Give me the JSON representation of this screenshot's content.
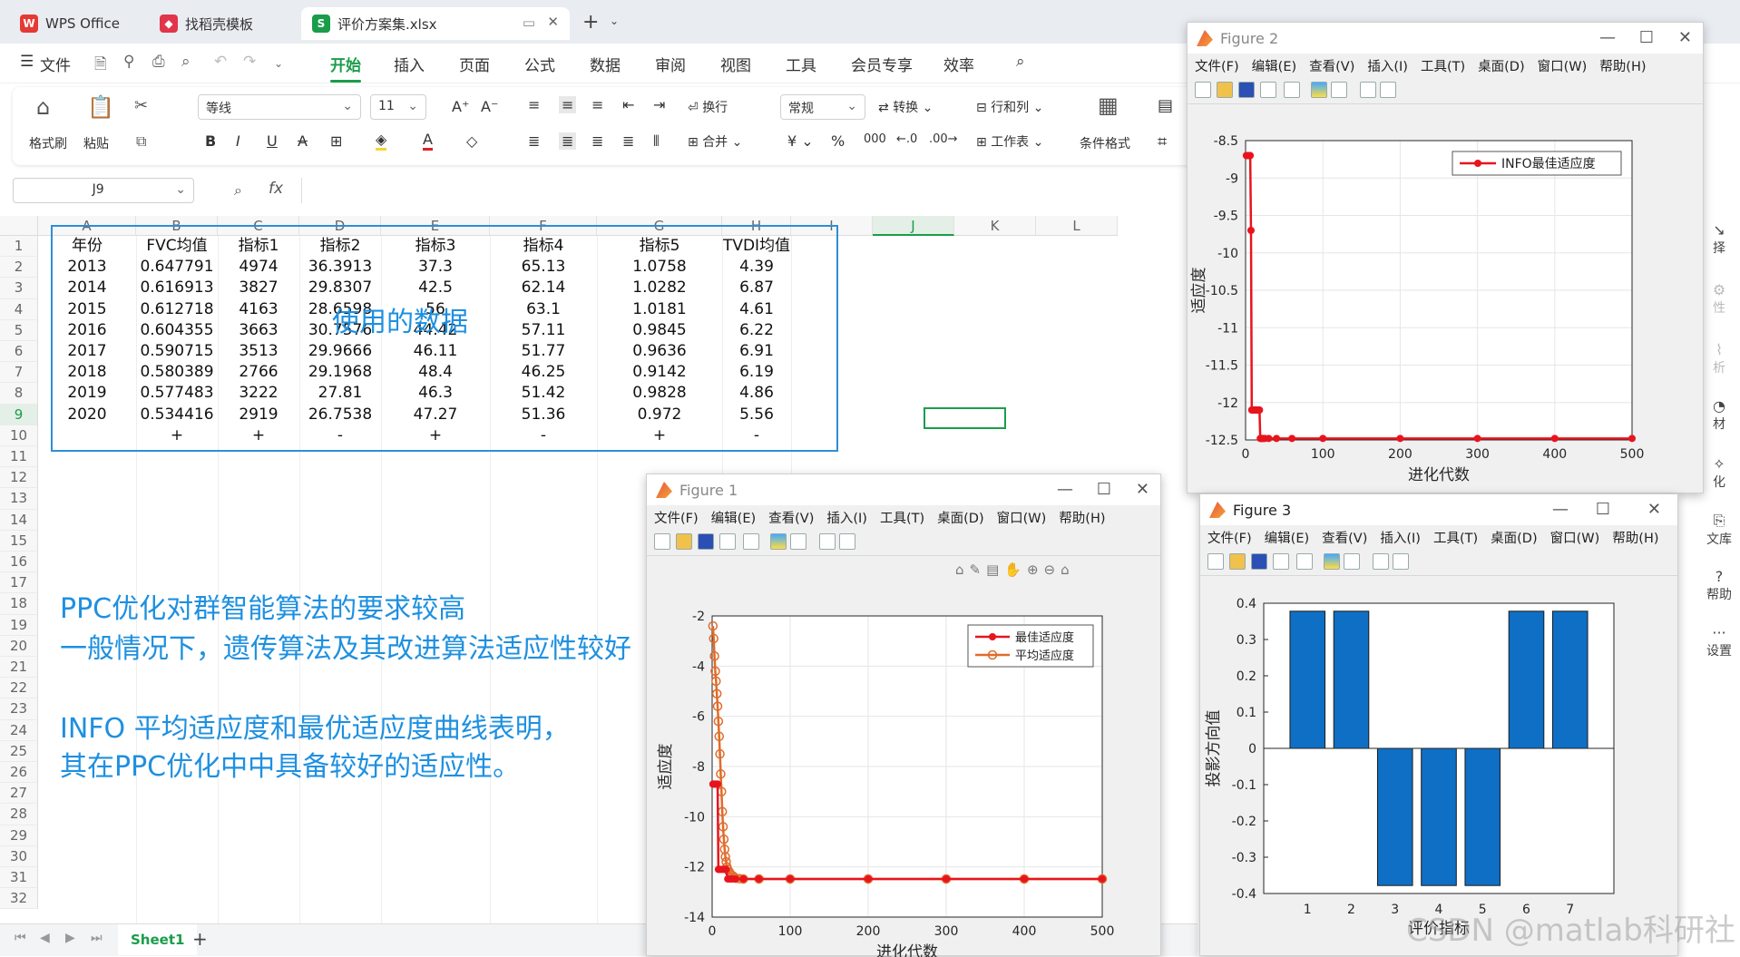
{
  "tabs": [
    {
      "label": "WPS Office",
      "icon": "wps-logo-icon"
    },
    {
      "label": "找稻壳模板",
      "icon": "docer-icon"
    },
    {
      "label": "评价方案集.xlsx",
      "icon": "spreadsheet-icon"
    }
  ],
  "menu": {
    "file": "文件",
    "items": [
      "开始",
      "插入",
      "页面",
      "公式",
      "数据",
      "审阅",
      "视图",
      "工具",
      "会员专享",
      "效率"
    ]
  },
  "ribbon": {
    "format_painter": "格式刷",
    "paste": "粘贴",
    "font_name": "等线",
    "font_size": "11",
    "wrap": "换行",
    "merge": "合并",
    "number_format": "常规",
    "convert": "转换",
    "rowcol": "行和列",
    "worksheet": "工作表",
    "cond_format": "条件格式"
  },
  "formula_bar": {
    "cell_ref": "J9",
    "fx": "fx",
    "value": ""
  },
  "grid": {
    "columns": [
      "A",
      "B",
      "C",
      "D",
      "E",
      "F",
      "G",
      "H",
      "I",
      "J",
      "K",
      "L"
    ],
    "rows": [
      "1",
      "2",
      "3",
      "4",
      "5",
      "6",
      "7",
      "8",
      "9",
      "10",
      "11",
      "12",
      "13",
      "14",
      "15",
      "16",
      "17",
      "18",
      "19",
      "20",
      "21",
      "22",
      "23",
      "24",
      "25",
      "26",
      "27",
      "28",
      "29",
      "30",
      "31",
      "32"
    ],
    "table": [
      [
        "年份",
        "FVC均值",
        "指标1",
        "指标2",
        "指标3",
        "指标4",
        "指标5",
        "TVDI均值"
      ],
      [
        "2013",
        "0.647791",
        "4974",
        "36.3913",
        "37.3",
        "65.13",
        "1.0758",
        "4.39"
      ],
      [
        "2014",
        "0.616913",
        "3827",
        "29.8307",
        "42.5",
        "62.14",
        "1.0282",
        "6.87"
      ],
      [
        "2015",
        "0.612718",
        "4163",
        "28.6598",
        "56",
        "63.1",
        "1.0181",
        "4.61"
      ],
      [
        "2016",
        "0.604355",
        "3663",
        "30.7576",
        "44.42",
        "57.11",
        "0.9845",
        "6.22"
      ],
      [
        "2017",
        "0.590715",
        "3513",
        "29.9666",
        "46.11",
        "51.77",
        "0.9636",
        "6.91"
      ],
      [
        "2018",
        "0.580389",
        "2766",
        "29.1968",
        "48.4",
        "46.25",
        "0.9142",
        "6.19"
      ],
      [
        "2019",
        "0.577483",
        "3222",
        "27.81",
        "46.3",
        "51.42",
        "0.9828",
        "4.86"
      ],
      [
        "2020",
        "0.534416",
        "2919",
        "26.7538",
        "47.27",
        "51.36",
        "0.972",
        "5.56"
      ],
      [
        "",
        "+",
        "+",
        "-",
        "+",
        "-",
        "+",
        "-"
      ]
    ],
    "overlay_label": "使用的数据"
  },
  "notes": [
    "PPC优化对群智能算法的要求较高",
    "一般情况下，遗传算法及其改进算法适应性较好",
    "INFO 平均适应度和最优适应度曲线表明，",
    "其在PPC优化中中具备较好的适应性。"
  ],
  "sheet_tab": "Sheet1",
  "right_panel": [
    "择",
    "性",
    "析",
    "材",
    "化",
    "文库",
    "帮助",
    "设置"
  ],
  "figure_menu": [
    "文件(F)",
    "编辑(E)",
    "查看(V)",
    "插入(I)",
    "工具(T)",
    "桌面(D)",
    "窗口(W)",
    "帮助(H)"
  ],
  "watermark": "CSDN @matlab科研社",
  "colors": {
    "wps_green": "#1a9d4a",
    "note_blue": "#1e90e0",
    "best": "#e8141d",
    "avg": "#e06c2b",
    "bar": "#0e6fc4"
  },
  "chart_data": [
    {
      "window_title": "Figure 2",
      "type": "line",
      "xlabel": "进化代数",
      "ylabel": "适应度",
      "xlim": [
        0,
        500
      ],
      "ylim": [
        -12.5,
        -8.5
      ],
      "xticks": [
        0,
        100,
        200,
        300,
        400,
        500
      ],
      "yticks": [
        -8.5,
        -9,
        -9.5,
        -10,
        -10.5,
        -11,
        -11.5,
        -12,
        -12.5
      ],
      "legend_position": "top-right",
      "series": [
        {
          "name": "INFO最佳适应度",
          "x": [
            1,
            2,
            3,
            4,
            5,
            6,
            7,
            8,
            9,
            10,
            11,
            12,
            13,
            14,
            15,
            16,
            17,
            18,
            19,
            20,
            21,
            22,
            23,
            25,
            30,
            40,
            60,
            100,
            200,
            300,
            400,
            500
          ],
          "y": [
            -8.7,
            -8.7,
            -8.7,
            -8.7,
            -8.7,
            -8.7,
            -9.7,
            -12.1,
            -12.1,
            -12.1,
            -12.1,
            -12.1,
            -12.1,
            -12.1,
            -12.1,
            -12.1,
            -12.1,
            -12.1,
            -12.48,
            -12.48,
            -12.48,
            -12.48,
            -12.48,
            -12.48,
            -12.48,
            -12.48,
            -12.48,
            -12.48,
            -12.48,
            -12.48,
            -12.48,
            -12.48
          ]
        }
      ]
    },
    {
      "window_title": "Figure 1",
      "type": "line",
      "xlabel": "进化代数",
      "ylabel": "适应度",
      "xlim": [
        0,
        500
      ],
      "ylim": [
        -14,
        -2
      ],
      "xticks": [
        0,
        100,
        200,
        300,
        400,
        500
      ],
      "yticks": [
        -2,
        -4,
        -6,
        -8,
        -10,
        -12,
        -14
      ],
      "legend_position": "top-right",
      "series": [
        {
          "name": "最佳适应度",
          "x": [
            1,
            2,
            3,
            4,
            5,
            6,
            7,
            8,
            9,
            10,
            12,
            14,
            16,
            18,
            20,
            22,
            24,
            26,
            30,
            40,
            60,
            100,
            200,
            300,
            400,
            500
          ],
          "y": [
            -8.7,
            -8.7,
            -8.7,
            -8.7,
            -8.7,
            -8.7,
            -8.7,
            -12.1,
            -12.1,
            -12.1,
            -12.1,
            -12.1,
            -12.1,
            -12.1,
            -12.48,
            -12.48,
            -12.48,
            -12.48,
            -12.48,
            -12.48,
            -12.48,
            -12.48,
            -12.48,
            -12.48,
            -12.48,
            -12.48
          ]
        },
        {
          "name": "平均适应度",
          "x": [
            1,
            2,
            3,
            4,
            5,
            6,
            7,
            8,
            9,
            10,
            11,
            12,
            13,
            14,
            15,
            16,
            17,
            18,
            19,
            20,
            22,
            24,
            26,
            28,
            30,
            35,
            40,
            60,
            100,
            200,
            300,
            400,
            500
          ],
          "y": [
            -2.4,
            -2.9,
            -3.6,
            -4.2,
            -4.6,
            -5.1,
            -5.6,
            -6.2,
            -6.8,
            -7.5,
            -8.3,
            -9.0,
            -9.8,
            -10.4,
            -10.9,
            -11.3,
            -11.6,
            -11.8,
            -12.0,
            -12.1,
            -12.2,
            -12.3,
            -12.35,
            -12.4,
            -12.45,
            -12.47,
            -12.48,
            -12.48,
            -12.48,
            -12.48,
            -12.48,
            -12.48,
            -12.48
          ]
        }
      ]
    },
    {
      "window_title": "Figure 3",
      "type": "bar",
      "xlabel": "评价指标",
      "ylabel": "投影方向值",
      "categories": [
        "1",
        "2",
        "3",
        "4",
        "5",
        "6",
        "7"
      ],
      "values": [
        0.378,
        0.378,
        -0.378,
        -0.378,
        -0.378,
        0.378,
        0.378
      ],
      "ylim": [
        -0.4,
        0.4
      ],
      "yticks": [
        0.4,
        0.3,
        0.2,
        0.1,
        0,
        -0.1,
        -0.2,
        -0.3,
        -0.4
      ]
    }
  ]
}
